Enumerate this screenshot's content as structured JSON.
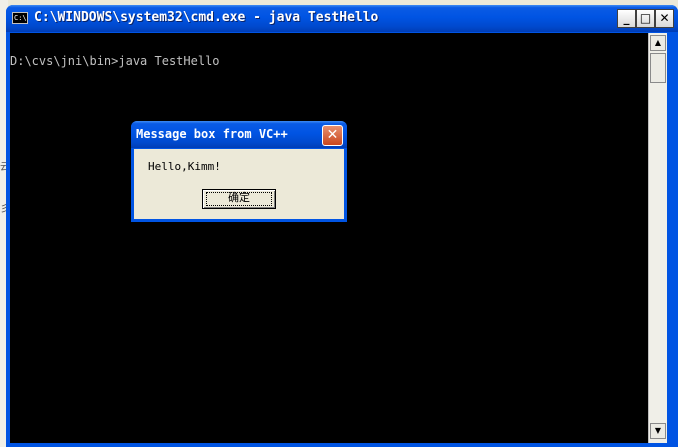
{
  "window": {
    "title": "C:\\WINDOWS\\system32\\cmd.exe - java TestHello",
    "icon_text": "C:\\",
    "buttons": {
      "minimize": "_",
      "maximize": "□",
      "close": "✕"
    }
  },
  "console": {
    "lines": [
      "D:\\cvs\\jni\\bin>java TestHello"
    ]
  },
  "scrollbar": {
    "up": "▲",
    "down": "▼"
  },
  "message_box": {
    "title": "Message box from VC++",
    "close": "✕",
    "message": "Hello,Kimm!",
    "ok_label": "确定"
  },
  "background": {
    "glyph1": "云",
    "glyph2": "彡"
  },
  "colors": {
    "titlebar": "#0054e3",
    "console_bg": "#000000",
    "console_text": "#c0c0c0",
    "dialog_bg": "#ece9d8"
  }
}
